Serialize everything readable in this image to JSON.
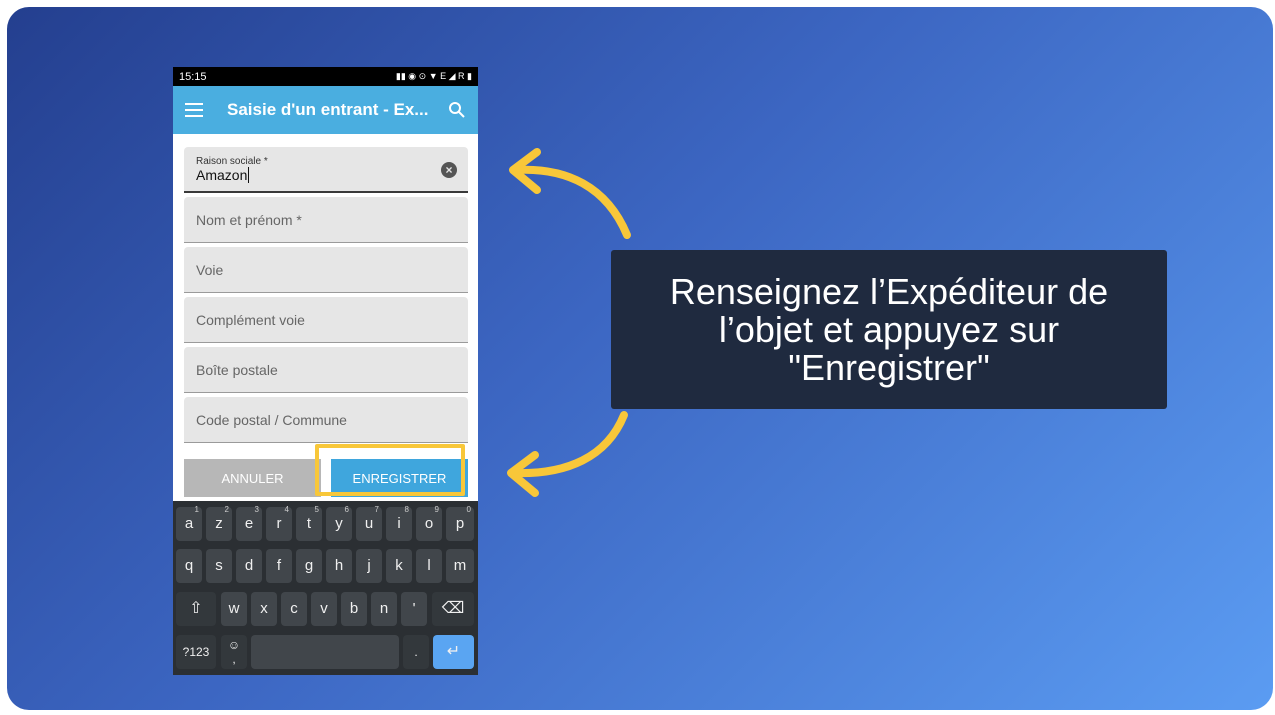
{
  "status_bar": {
    "time": "15:15",
    "icons_text": "▮▮ ◉ ⊙ ▼ E ◢ R ▮"
  },
  "app_bar": {
    "title": "Saisie d'un entrant - Ex...",
    "menu_icon": "menu-icon",
    "search_icon": "search-icon"
  },
  "form": {
    "fields": [
      {
        "label": "Raison sociale *",
        "value": "Amazon"
      },
      {
        "placeholder": "Nom et prénom *"
      },
      {
        "placeholder": "Voie"
      },
      {
        "placeholder": "Complément voie"
      },
      {
        "placeholder": "Boîte postale"
      },
      {
        "placeholder": "Code postal / Commune"
      }
    ],
    "clear_icon": "×"
  },
  "buttons": {
    "cancel": "ANNULER",
    "save": "ENREGISTRER"
  },
  "keyboard": {
    "row1": [
      {
        "k": "a",
        "n": "1"
      },
      {
        "k": "z",
        "n": "2"
      },
      {
        "k": "e",
        "n": "3"
      },
      {
        "k": "r",
        "n": "4"
      },
      {
        "k": "t",
        "n": "5"
      },
      {
        "k": "y",
        "n": "6"
      },
      {
        "k": "u",
        "n": "7"
      },
      {
        "k": "i",
        "n": "8"
      },
      {
        "k": "o",
        "n": "9"
      },
      {
        "k": "p",
        "n": "0"
      }
    ],
    "row2": [
      "q",
      "s",
      "d",
      "f",
      "g",
      "h",
      "j",
      "k",
      "l",
      "m"
    ],
    "row3": [
      "w",
      "x",
      "c",
      "v",
      "b",
      "n",
      "'"
    ],
    "shift": "⇧",
    "backspace": "⌫",
    "numbers": "?123",
    "emoji": "☺",
    "comma": ",",
    "period": ".",
    "enter": "↵"
  },
  "callout": {
    "line1": "Renseignez l’Expéditeur de",
    "line2": "l’objet et appuyez sur",
    "line3": "\"Enregistrer\""
  },
  "colors": {
    "accent": "#4aaee0",
    "highlight": "#f8c739",
    "callout_bg": "#1f2a3f"
  }
}
